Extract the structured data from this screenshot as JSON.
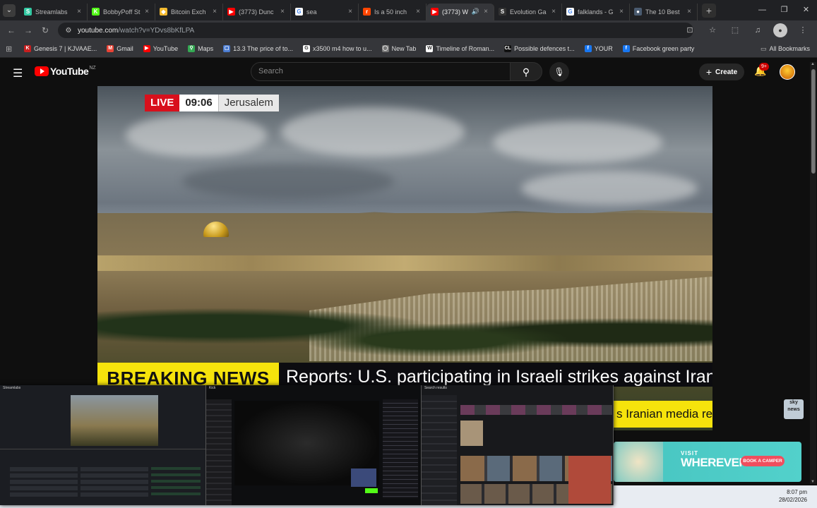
{
  "browser": {
    "tabs": [
      {
        "title": "Streamlabs",
        "fav_color": "#33c9a3",
        "fav_text": "S"
      },
      {
        "title": "BobbyPoff St",
        "fav_color": "#53fc18",
        "fav_text": "K"
      },
      {
        "title": "Bitcoin Exch",
        "fav_color": "#f3ba2f",
        "fav_text": "◆"
      },
      {
        "title": "(3773) Dunc",
        "fav_color": "#ff0000",
        "fav_text": "▶"
      },
      {
        "title": "sea",
        "fav_color": "#ffffff",
        "fav_text": "G"
      },
      {
        "title": "Is a 50 inch",
        "fav_color": "#ff4500",
        "fav_text": "r"
      },
      {
        "title": "(3773) W",
        "fav_color": "#ff0000",
        "fav_text": "▶",
        "active": true
      },
      {
        "title": "Evolution Ga",
        "fav_color": "#333333",
        "fav_text": "S"
      },
      {
        "title": "falklands - G",
        "fav_color": "#ffffff",
        "fav_text": "G"
      },
      {
        "title": "The 10 Best",
        "fav_color": "#4a5b70",
        "fav_text": "●"
      }
    ],
    "new_tab_icon": "+",
    "url_host": "youtube.com",
    "url_path": "/watch?v=YDvs8bKfLPA",
    "bookmarks": [
      {
        "label": "Genesis 7 | KJVAAE...",
        "color": "#c81f1f",
        "icon": "K"
      },
      {
        "label": "Gmail",
        "color": "#ea4335",
        "icon": "M"
      },
      {
        "label": "YouTube",
        "color": "#ff0000",
        "icon": "▶"
      },
      {
        "label": "Maps",
        "color": "#34a853",
        "icon": "⚲"
      },
      {
        "label": "13.3 The price of to...",
        "color": "#4a7bd0",
        "icon": "▢"
      },
      {
        "label": "x3500 m4 how to u...",
        "color": "#ffffff",
        "icon": "G"
      },
      {
        "label": "New Tab",
        "color": "#777777",
        "icon": "◯"
      },
      {
        "label": "Timeline of Roman...",
        "color": "#ffffff",
        "icon": "W"
      },
      {
        "label": "Possible defences t...",
        "color": "#111111",
        "icon": "CL"
      },
      {
        "label": "YOUR",
        "color": "#1877f2",
        "icon": "f"
      },
      {
        "label": "Facebook green party",
        "color": "#1877f2",
        "icon": "f"
      }
    ],
    "all_bookmarks": "All Bookmarks"
  },
  "youtube": {
    "logo_text": "YouTube",
    "country_code": "NZ",
    "search_placeholder": "Search",
    "create_label": "Create",
    "notif_badge": "9+"
  },
  "video": {
    "live_label": "LIVE",
    "time": "09:06",
    "location": "Jerusalem",
    "breaking_label": "BREAKING NEWS",
    "headline": "Reports: U.S. participating in Israeli strikes against Iran",
    "ticker": "s Iranian media rep",
    "channel_bug": "sky news"
  },
  "ad": {
    "visit": "VISIT",
    "brand": "WHEREVER",
    "cta": "BOOK A CAMPER"
  },
  "taskbar": {
    "time": "8:07 pm",
    "date": "28/02/2026"
  },
  "thumbnails": [
    {
      "title": "Streamlabs"
    },
    {
      "title": "Kick"
    },
    {
      "title": "Search results"
    }
  ]
}
